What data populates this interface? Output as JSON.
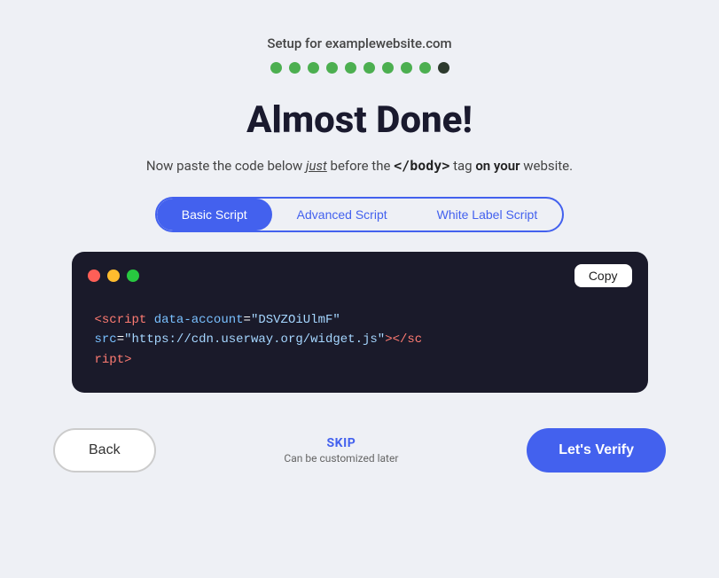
{
  "setup": {
    "label_prefix": "Setup for ",
    "domain": "examplewebsite.com"
  },
  "dots": {
    "items": [
      {
        "color": "green"
      },
      {
        "color": "green"
      },
      {
        "color": "green"
      },
      {
        "color": "green"
      },
      {
        "color": "green"
      },
      {
        "color": "green"
      },
      {
        "color": "green"
      },
      {
        "color": "green"
      },
      {
        "color": "green"
      },
      {
        "color": "dark"
      }
    ]
  },
  "heading": "Almost Done!",
  "instruction": {
    "before": "Now paste the code below ",
    "just": "just",
    "middle": " before the ",
    "body_tag": "</body>",
    "after": " tag ",
    "on_your": "on your",
    "end": " website."
  },
  "tabs": {
    "items": [
      {
        "label": "Basic Script",
        "active": true
      },
      {
        "label": "Advanced Script",
        "active": false
      },
      {
        "label": "White Label Script",
        "active": false
      }
    ]
  },
  "code": {
    "copy_label": "Copy",
    "content": "<script data-account=\"DSVZOiUlmF\" src=\"https://cdn.userway.org/widget.js\"></script>"
  },
  "footer": {
    "back_label": "Back",
    "skip_label": "SKIP",
    "skip_sub": "Can be customized later",
    "verify_label": "Let's Verify"
  }
}
